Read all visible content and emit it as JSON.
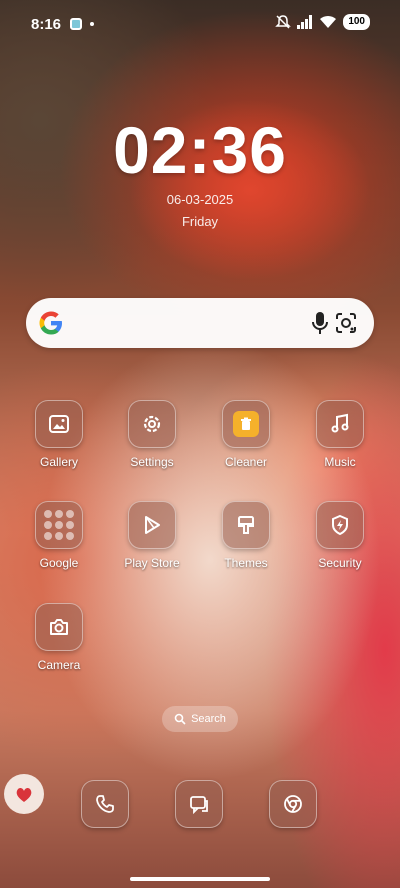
{
  "status_bar": {
    "time": "8:16",
    "battery": "100",
    "icons": [
      "app-notification-icon",
      "mute-icon",
      "wifi-icon",
      "signal-icon",
      "battery-icon"
    ]
  },
  "lockclock": {
    "time": "02:36",
    "date": "06-03-2025",
    "day": "Friday"
  },
  "search_widget": {
    "icons": [
      "google-logo-icon",
      "mic-icon",
      "google-lens-icon"
    ]
  },
  "apps": [
    {
      "label": "Gallery",
      "icon": "gallery-icon"
    },
    {
      "label": "Settings",
      "icon": "gear-icon"
    },
    {
      "label": "Cleaner",
      "icon": "cleaner-icon"
    },
    {
      "label": "Music",
      "icon": "music-icon"
    },
    {
      "label": "Google",
      "icon": "google-folder-icon"
    },
    {
      "label": "Play Store",
      "icon": "play-store-icon"
    },
    {
      "label": "Themes",
      "icon": "themes-brush-icon"
    },
    {
      "label": "Security",
      "icon": "shield-bolt-icon"
    },
    {
      "label": "Camera",
      "icon": "camera-icon"
    }
  ],
  "app_search": {
    "label": "Search"
  },
  "dock": [
    {
      "icon": "phone-icon"
    },
    {
      "icon": "messages-icon"
    },
    {
      "icon": "chrome-icon"
    }
  ],
  "colors": {
    "cleaner_accent": "#f5b12b"
  }
}
